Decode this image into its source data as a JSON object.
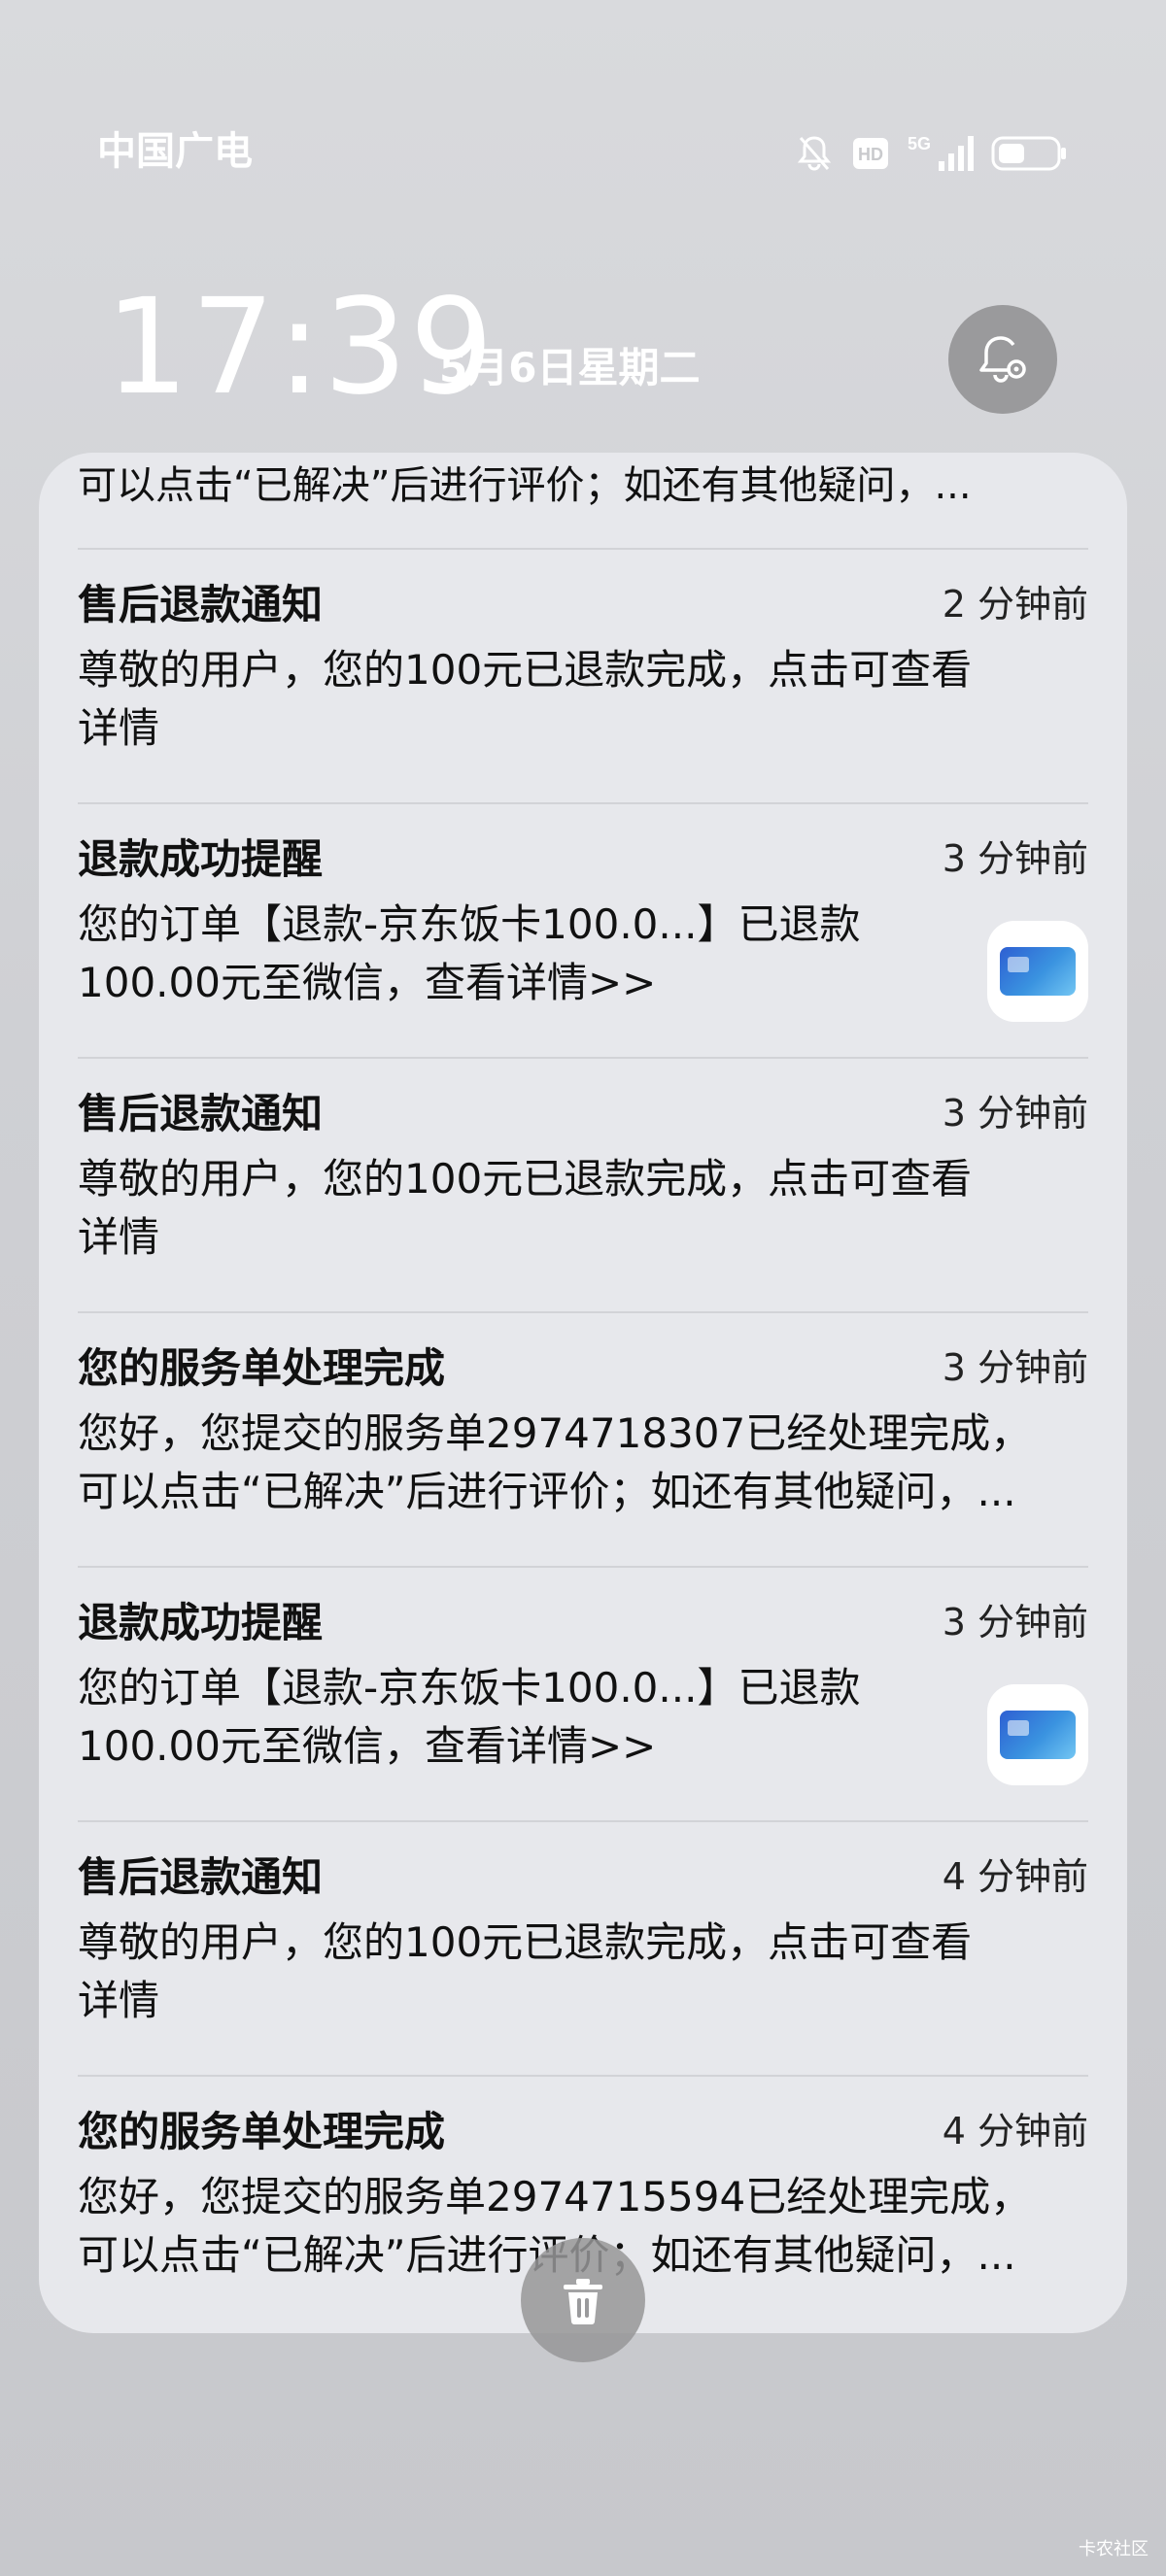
{
  "statusbar": {
    "carrier": "中国广电",
    "icons": [
      "bell-muted-icon",
      "hd-icon",
      "5g-signal-icon",
      "battery-icon"
    ]
  },
  "lockscreen": {
    "time": "17:39",
    "date": "5月6日星期二"
  },
  "notifications": {
    "top_partial": "可以点击“已解决”后进行评价；如还有其他疑问，...",
    "items": [
      {
        "title": "售后退款通知",
        "time": "2 分钟前",
        "line1": "尊敬的用户，您的100元已退款完成，点击可查看",
        "line2": "详情"
      },
      {
        "title": "退款成功提醒",
        "time": "3 分钟前",
        "line1": "您的订单【退款-京东饭卡100.0...】已退款",
        "line2": "100.00元至微信，查看详情>>"
      },
      {
        "title": "售后退款通知",
        "time": "3 分钟前",
        "line1": "尊敬的用户，您的100元已退款完成，点击可查看",
        "line2": "详情"
      },
      {
        "title": "您的服务单处理完成",
        "time": "3 分钟前",
        "line1": "您好，您提交的服务单2974718307已经处理完成，",
        "line2": "可以点击“已解决”后进行评价；如还有其他疑问，..."
      },
      {
        "title": "退款成功提醒",
        "time": "3 分钟前",
        "line1": "您的订单【退款-京东饭卡100.0...】已退款",
        "line2": "100.00元至微信，查看详情>>"
      },
      {
        "title": "售后退款通知",
        "time": "4 分钟前",
        "line1": "尊敬的用户，您的100元已退款完成，点击可查看",
        "line2": "详情"
      },
      {
        "title": "您的服务单处理完成",
        "time": "4 分钟前",
        "line1": "您好，您提交的服务单2974715594已经处理完成，",
        "line2": "可以点击“已解决”后进行评价；如还有其他疑问，..."
      }
    ]
  },
  "watermark": "卡农社区"
}
